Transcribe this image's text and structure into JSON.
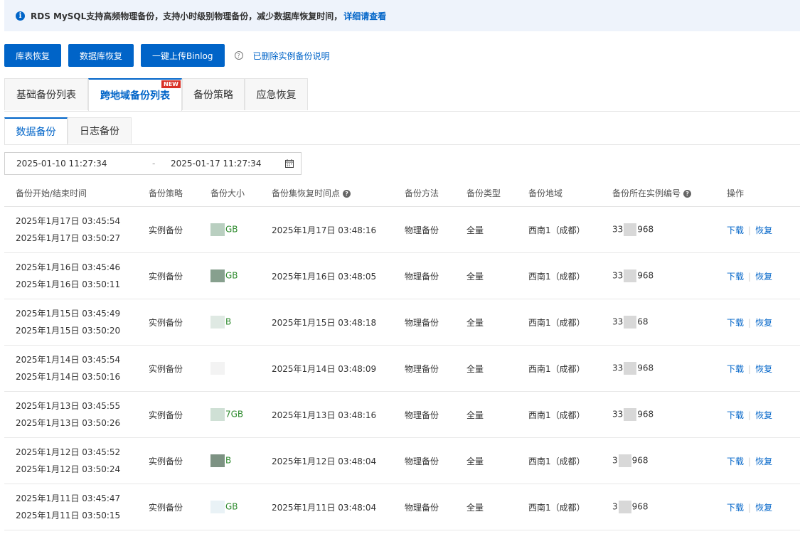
{
  "notice": {
    "text": "RDS MySQL支持高频物理备份，支持小时级别物理备份，减少数据库恢复时间，",
    "link": "详细请查看"
  },
  "toolbar": {
    "buttons": [
      "库表恢复",
      "数据库恢复",
      "一键上传Binlog"
    ],
    "deleted_link": "已删除实例备份说明"
  },
  "tabs": [
    {
      "label": "基础备份列表"
    },
    {
      "label": "跨地域备份列表",
      "badge": "NEW"
    },
    {
      "label": "备份策略"
    },
    {
      "label": "应急恢复"
    }
  ],
  "subtabs": [
    {
      "label": "数据备份"
    },
    {
      "label": "日志备份"
    }
  ],
  "date_range": {
    "start": "2025-01-10 11:27:34",
    "separator": "-",
    "end": "2025-01-17 11:27:34"
  },
  "table": {
    "headers": [
      "备份开始/结束时间",
      "备份策略",
      "备份大小",
      "备份集恢复时间点",
      "备份方法",
      "备份类型",
      "备份地域",
      "备份所在实例编号",
      "操作"
    ],
    "rows": [
      {
        "start": "2025年1月17日 03:45:54",
        "end": "2025年1月17日 03:50:27",
        "policy": "实例备份",
        "size": "GB",
        "restore": "2025年1月17日 03:48:16",
        "method": "物理备份",
        "type": "全量",
        "region": "西南1（成都）",
        "inst_pre": "33",
        "inst_post": "968",
        "download": "下载",
        "recover": "恢复"
      },
      {
        "start": "2025年1月16日 03:45:46",
        "end": "2025年1月16日 03:50:11",
        "policy": "实例备份",
        "size": "GB",
        "restore": "2025年1月16日 03:48:05",
        "method": "物理备份",
        "type": "全量",
        "region": "西南1（成都）",
        "inst_pre": "33",
        "inst_post": "968",
        "download": "下载",
        "recover": "恢复"
      },
      {
        "start": "2025年1月15日 03:45:49",
        "end": "2025年1月15日 03:50:20",
        "policy": "实例备份",
        "size": "B",
        "restore": "2025年1月15日 03:48:18",
        "method": "物理备份",
        "type": "全量",
        "region": "西南1（成都）",
        "inst_pre": "33",
        "inst_post": "68",
        "download": "下载",
        "recover": "恢复"
      },
      {
        "start": "2025年1月14日 03:45:54",
        "end": "2025年1月14日 03:50:16",
        "policy": "实例备份",
        "size": "",
        "restore": "2025年1月14日 03:48:09",
        "method": "物理备份",
        "type": "全量",
        "region": "西南1（成都）",
        "inst_pre": "33",
        "inst_post": "968",
        "download": "下载",
        "recover": "恢复"
      },
      {
        "start": "2025年1月13日 03:45:55",
        "end": "2025年1月13日 03:50:26",
        "policy": "实例备份",
        "size": "7GB",
        "restore": "2025年1月13日 03:48:16",
        "method": "物理备份",
        "type": "全量",
        "region": "西南1（成都）",
        "inst_pre": "33",
        "inst_post": "968",
        "download": "下载",
        "recover": "恢复"
      },
      {
        "start": "2025年1月12日 03:45:52",
        "end": "2025年1月12日 03:50:24",
        "policy": "实例备份",
        "size": "B",
        "restore": "2025年1月12日 03:48:04",
        "method": "物理备份",
        "type": "全量",
        "region": "西南1（成都）",
        "inst_pre": "3",
        "inst_post": "968",
        "download": "下载",
        "recover": "恢复"
      },
      {
        "start": "2025年1月11日 03:45:47",
        "end": "2025年1月11日 03:50:15",
        "policy": "实例备份",
        "size": "GB",
        "restore": "2025年1月11日 03:48:04",
        "method": "物理备份",
        "type": "全量",
        "region": "西南1（成都）",
        "inst_pre": "3",
        "inst_post": "968",
        "download": "下载",
        "recover": "恢复"
      }
    ]
  },
  "colors": {
    "accent": "#0064c8",
    "badge": "#d93026",
    "size_text": "#2d8a2d"
  }
}
